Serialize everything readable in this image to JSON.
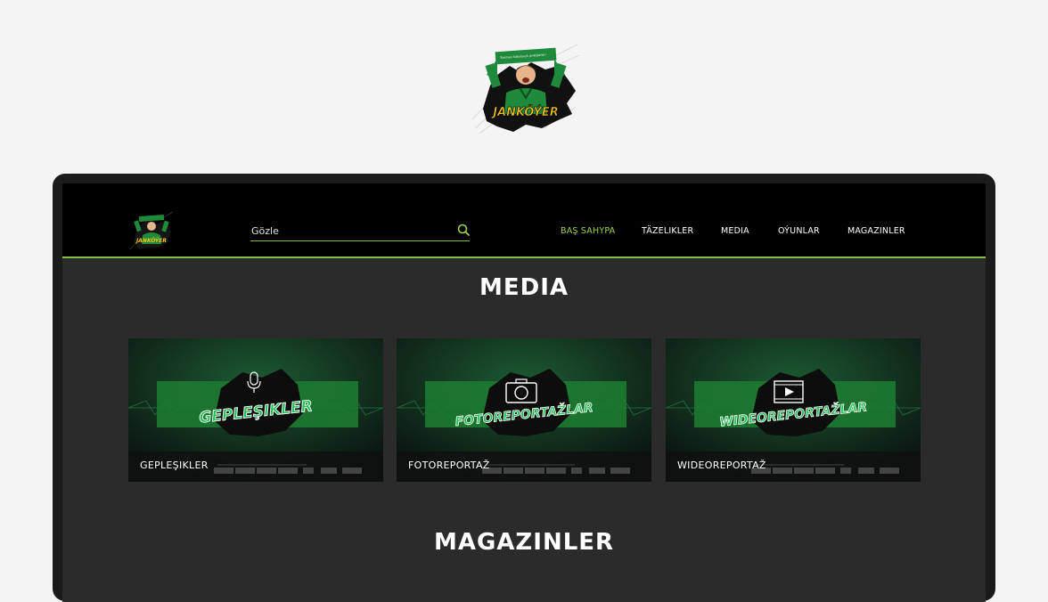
{
  "brand": {
    "name": "JANKÖÝER",
    "logo_banner_text": "Türkmen futbolynyň janköýerleri",
    "colors": {
      "accent": "#7fc242",
      "nav_active": "#9fd24a",
      "header_bg": "#000000",
      "page_bg": "#2b2b2b"
    }
  },
  "header": {
    "search": {
      "placeholder": "Gözle",
      "icon": "search-icon"
    },
    "nav": [
      {
        "label": "BAŞ SAHYPA",
        "active": true
      },
      {
        "label": "TÄZELIKLER",
        "active": false
      },
      {
        "label": "MEDIA",
        "active": false
      },
      {
        "label": "OÝUNLAR",
        "active": false
      },
      {
        "label": "MAGAZINLER",
        "active": false
      }
    ]
  },
  "main": {
    "media_title": "MEDIA",
    "cards": [
      {
        "banner": "GEPLEŞIKLER",
        "label": "GEPLEŞIKLER",
        "icon": "microphone-icon"
      },
      {
        "banner": "FOTOREPORTAŽLAR",
        "label": "FOTOREPORTAŽ",
        "icon": "camera-icon"
      },
      {
        "banner": "WIDEOREPORTAŽLAR",
        "label": "WIDEOREPORTAŽ",
        "icon": "video-play-icon"
      }
    ],
    "magazinler_title": "MAGAZINLER"
  }
}
